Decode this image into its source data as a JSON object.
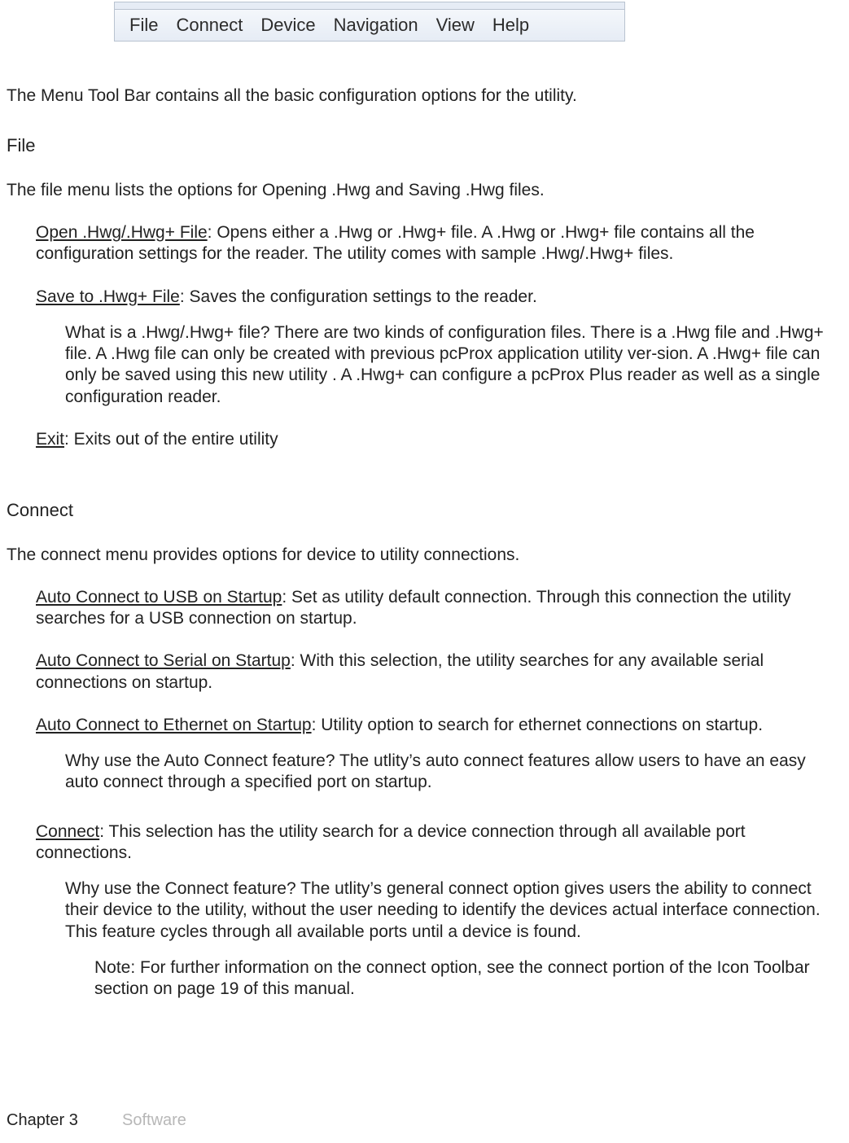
{
  "menu": {
    "items": [
      "File",
      "Connect",
      "Device",
      "Navigation",
      "View",
      "Help"
    ]
  },
  "lead": "The Menu  Tool  Bar contains  all the basic configuration  options  for the utility.",
  "file": {
    "heading": "File",
    "intro": "The file menu lists the options for Opening  .Hwg  and Saving .Hwg  files.",
    "open_label": "Open .Hwg/.Hwg+  File",
    "open_desc": ": Opens either  a .Hwg or .Hwg+ file.  A .Hwg or .Hwg+ file contains all the configuration settings for the reader. The utility comes with sample .Hwg/.Hwg+ files.",
    "save_label": "Save to .Hwg+  File",
    "save_desc": ": Saves the configuration settings to the reader.",
    "what_is": "What is a .Hwg/.Hwg+  file? There are two kinds of configuration  files. There is a .Hwg  file and .Hwg+ file. A .Hwg file can only be created with previous pcProx application utility ver-sion. A .Hwg+ file can only be saved using this new utility . A .Hwg+  can configure a pcProx Plus reader as well as a single configuration  reader.",
    "exit_label": "Exit",
    "exit_desc": ": Exits out of the entire utility"
  },
  "connect": {
    "heading": "Connect",
    "intro": "The connect menu provides options for device to utility connections.",
    "auto_usb_label": "Auto Connect to USB on Startup",
    "auto_usb_desc": ":  Set as utility default connection. Through this connection the utility searches for a USB connection on startup.",
    "auto_serial_label": "Auto Connect to Serial on Startup",
    "auto_serial_desc": ": With this selection, the utility searches for any available serial connections on startup.",
    "auto_eth_label": "Auto Connect to Ethernet on Startup",
    "auto_eth_desc": ":  Utility option to search for ethernet connections on startup.",
    "why_auto": "Why use the Auto Connect feature? The utlity’s auto connect features allow users to have an easy auto connect through a specified port on startup.",
    "connect_label": "Connect",
    "connect_desc": ": This selection has the utility search for a device connection through all available port connections.",
    "why_connect": "Why use the Connect feature? The utlity’s general connect option gives users the ability to connect their device to the utility, without the user needing to identify the devices actual interface connection. This feature cycles through all available ports until a device is found.",
    "note": "Note: For further information  on the connect option,  see the connect portion of the Icon Toolbar  section  on page 19 of this manual."
  },
  "footer": {
    "chapter": "Chapter 3",
    "section": "Software"
  }
}
